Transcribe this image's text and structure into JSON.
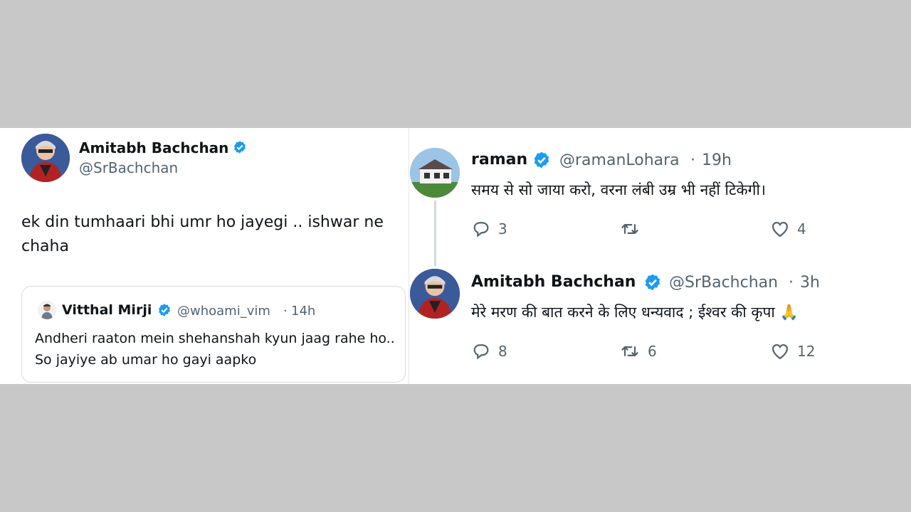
{
  "left_tweet": {
    "author_name": "Amitabh Bachchan",
    "author_handle": "@SrBachchan",
    "text": "ek din tumhaari bhi umr ho jayegi .. ishwar ne chaha",
    "quote": {
      "author_name": "Vitthal Mirji",
      "author_handle": "@whoami_vim",
      "dot": "·",
      "time": "14h",
      "text": "Andheri raaton mein shehanshah kyun jaag rahe ho.. So jayiye ab umar ho gayi aapko"
    }
  },
  "reply_1": {
    "author_name": "raman",
    "author_handle": "@ramanLohara",
    "dot": "·",
    "time": "19h",
    "text": "समय से सो जाया करो, वरना लंबी उम्र भी नहीं टिकेगी।",
    "replies": "3",
    "retweets": "",
    "likes": "4"
  },
  "reply_2": {
    "author_name": "Amitabh Bachchan",
    "author_handle": "@SrBachchan",
    "dot": "·",
    "time": "3h",
    "text": "मेरे मरण की बात करने के लिए धन्यवाद  ; ईश्वर  की कृपा 🙏",
    "replies": "8",
    "retweets": "6",
    "likes": "12"
  },
  "colors": {
    "verified": "#1d9bf0",
    "secondary_text": "#536471",
    "background_outer": "#c8c8c8"
  },
  "icons": [
    "verified-badge-icon",
    "reply-icon",
    "retweet-icon",
    "like-icon"
  ]
}
